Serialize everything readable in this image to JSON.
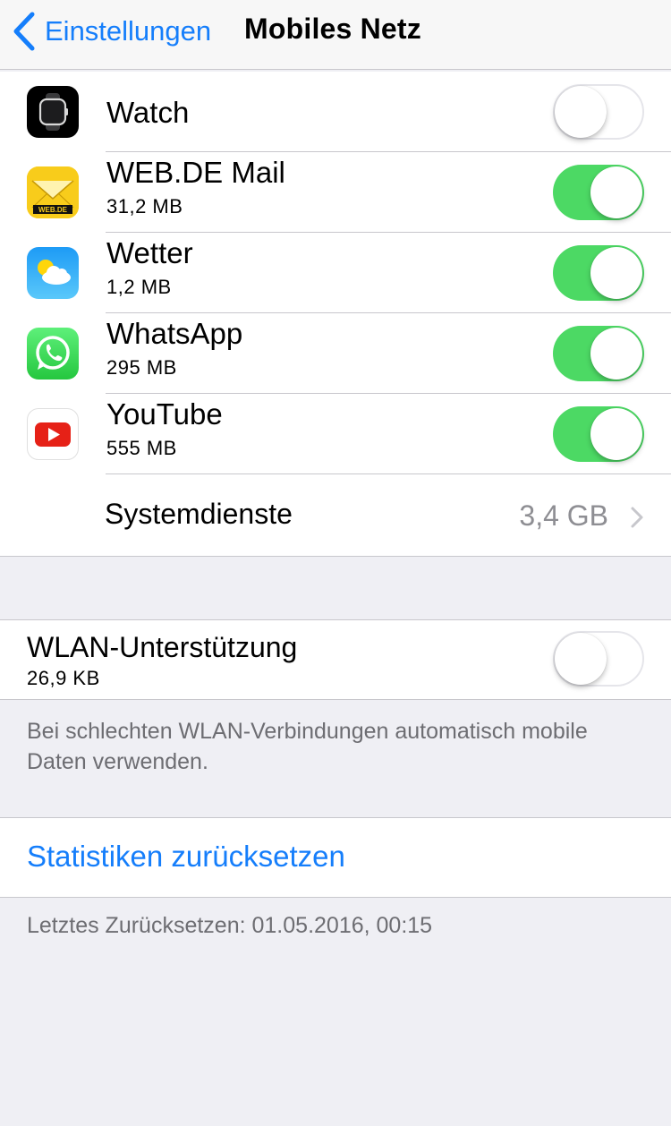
{
  "nav": {
    "back_label": "Einstellungen",
    "title": "Mobiles Netz"
  },
  "apps": [
    {
      "name": "Watch",
      "size": "",
      "icon": "apple-watch-icon",
      "enabled": false
    },
    {
      "name": "WEB.DE Mail",
      "size": "31,2 MB",
      "icon": "webde-mail-icon",
      "icon_text": "WEB.DE",
      "enabled": true
    },
    {
      "name": "Wetter",
      "size": "1,2 MB",
      "icon": "weather-icon",
      "enabled": true
    },
    {
      "name": "WhatsApp",
      "size": "295 MB",
      "icon": "whatsapp-icon",
      "enabled": true
    },
    {
      "name": "YouTube",
      "size": "555 MB",
      "icon": "youtube-icon",
      "enabled": true
    }
  ],
  "system_services": {
    "label": "Systemdienste",
    "value": "3,4 GB"
  },
  "wlan_assist": {
    "label": "WLAN-Unterstützung",
    "size": "26,9 KB",
    "enabled": false,
    "footer_line1": "Bei schlechten WLAN-Verbindungen automatisch mobile",
    "footer_line2": "Daten verwenden."
  },
  "reset": {
    "button_label": "Statistiken zurücksetzen",
    "last_reset": "Letztes Zurücksetzen: 01.05.2016, 00:15"
  },
  "colors": {
    "accent": "#157efb",
    "switch_on": "#4cd964",
    "background": "#efeff4",
    "secondary_text": "#8e8e93"
  }
}
